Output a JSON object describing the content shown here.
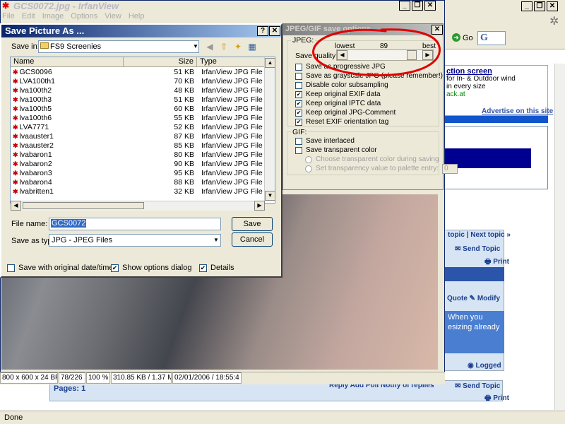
{
  "irfanview": {
    "title": "GCS0072.jpg - IrfanView",
    "menu": [
      "File",
      "Edit",
      "Image",
      "Options",
      "View",
      "Help"
    ],
    "status": [
      "800 x 600 x 24 BP",
      "78/226",
      "100 %",
      "310.85 KB / 1.37 M",
      "02/01/2006 / 18:55:4"
    ]
  },
  "save_dialog": {
    "title": "Save Picture As ...",
    "save_in_label": "Save in:",
    "save_in_value": "FS9 Screenies",
    "columns": [
      "Name",
      "Size",
      "Type"
    ],
    "files": [
      {
        "name": "GCS0096",
        "size": "51 KB",
        "type": "IrfanView JPG File"
      },
      {
        "name": "LVA100th1",
        "size": "70 KB",
        "type": "IrfanView JPG File"
      },
      {
        "name": "lva100th2",
        "size": "48 KB",
        "type": "IrfanView JPG File"
      },
      {
        "name": "lva100th3",
        "size": "51 KB",
        "type": "IrfanView JPG File"
      },
      {
        "name": "lva100th5",
        "size": "60 KB",
        "type": "IrfanView JPG File"
      },
      {
        "name": "lva100th6",
        "size": "55 KB",
        "type": "IrfanView JPG File"
      },
      {
        "name": "LVA7771",
        "size": "52 KB",
        "type": "IrfanView JPG File"
      },
      {
        "name": "lvaauster1",
        "size": "87 KB",
        "type": "IrfanView JPG File"
      },
      {
        "name": "lvaauster2",
        "size": "85 KB",
        "type": "IrfanView JPG File"
      },
      {
        "name": "lvabaron1",
        "size": "80 KB",
        "type": "IrfanView JPG File"
      },
      {
        "name": "lvabaron2",
        "size": "90 KB",
        "type": "IrfanView JPG File"
      },
      {
        "name": "lvabaron3",
        "size": "95 KB",
        "type": "IrfanView JPG File"
      },
      {
        "name": "lvabaron4",
        "size": "88 KB",
        "type": "IrfanView JPG File"
      },
      {
        "name": "lvabritten1",
        "size": "32 KB",
        "type": "IrfanView JPG File"
      }
    ],
    "file_name_label": "File name:",
    "file_name_value": "GCS0072",
    "save_as_type_label": "Save as type:",
    "save_as_type_value": "JPG - JPEG Files",
    "save_button": "Save",
    "cancel_button": "Cancel",
    "opt_original_date": {
      "label": "Save with original date/time",
      "checked": false
    },
    "opt_show_options": {
      "label": "Show options dialog",
      "checked": true
    },
    "opt_details": {
      "label": "Details",
      "checked": true
    }
  },
  "jpeg_dialog": {
    "title": "JPEG/GIF save options",
    "jpeg_group": "JPEG:",
    "quality_lowest": "lowest",
    "quality_value": "89",
    "quality_best": "best",
    "quality_label": "Save quality:",
    "quality_level": 89,
    "options": [
      {
        "label": "Save as progressive JPG",
        "checked": false
      },
      {
        "label": "Save as grayscale JPG (please remember!)",
        "checked": false
      },
      {
        "label": "Disable color subsampling",
        "checked": false
      },
      {
        "label": "Keep original EXIF data",
        "checked": true
      },
      {
        "label": "Keep original IPTC data",
        "checked": true
      },
      {
        "label": "Keep original JPG-Comment",
        "checked": true
      },
      {
        "label": "Reset EXIF orientation tag",
        "checked": true
      }
    ],
    "gif_group": "GIF:",
    "gif_interlaced": "Save interlaced",
    "gif_transparent": "Save transparent color",
    "gif_choose": "Choose transparent color during saving",
    "gif_set": "Set transparency value to palette entry:",
    "gif_set_value": "0"
  },
  "browser": {
    "go_label": "Go",
    "ad_title": "ction screen",
    "ad_text_1": "for In- & Outdoor wind",
    "ad_text_2": "in every size",
    "ad_link": "ack.at",
    "advertise": "Advertise on this site",
    "topic_links": "topic | Next topic »",
    "send_topic": "Send Topic",
    "print": "Print",
    "quote": "Quote",
    "modify": "Modify",
    "when_you": "When you esizing already",
    "logged": "Logged",
    "pages": "Pages: 1",
    "reply_links": "Reply  Add Poll  Notify of replies",
    "status": "Done"
  },
  "colors": {
    "dialog_bg": "#ece9d8",
    "title_active": "#0a246a",
    "selection": "#316ac5",
    "annotation_red": "#e00000",
    "forum_blue": "#1a3e8c"
  }
}
